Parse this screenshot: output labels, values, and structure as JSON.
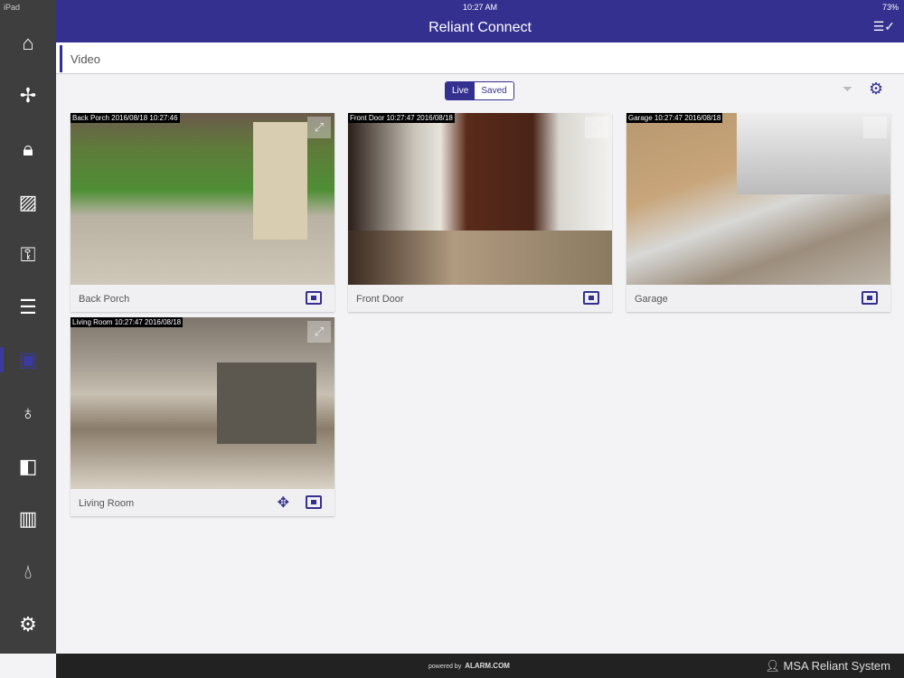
{
  "status_bar": {
    "device": "iPad",
    "time": "10:27 AM",
    "battery": "73%"
  },
  "header": {
    "title": "Reliant Connect"
  },
  "page": {
    "title": "Video"
  },
  "toggle": {
    "live": "Live",
    "saved": "Saved"
  },
  "sidebar": {
    "items": [
      {
        "icon": "home-icon"
      },
      {
        "icon": "thermostat-icon"
      },
      {
        "icon": "lock-icon"
      },
      {
        "icon": "sensor-icon"
      },
      {
        "icon": "key-icon"
      },
      {
        "icon": "garage-icon"
      },
      {
        "icon": "video-icon",
        "active": true
      },
      {
        "icon": "light-icon"
      },
      {
        "icon": "energy-icon"
      },
      {
        "icon": "chart-icon"
      },
      {
        "icon": "water-icon"
      },
      {
        "icon": "settings-icon"
      }
    ]
  },
  "cameras": [
    {
      "name": "Back Porch",
      "stamp": "Back Porch 2016/08/18 10:27:46"
    },
    {
      "name": "Front Door",
      "stamp": "Front Door 10:27:47 2016/08/18"
    },
    {
      "name": "Garage",
      "stamp": "Garage 10:27:47 2016/08/18"
    },
    {
      "name": "Living Room",
      "stamp": "Living Room 10:27:47 2016/08/18"
    }
  ],
  "footer": {
    "powered_by": "powered by",
    "brand": "ALARM.COM",
    "account": "MSA Reliant System"
  }
}
